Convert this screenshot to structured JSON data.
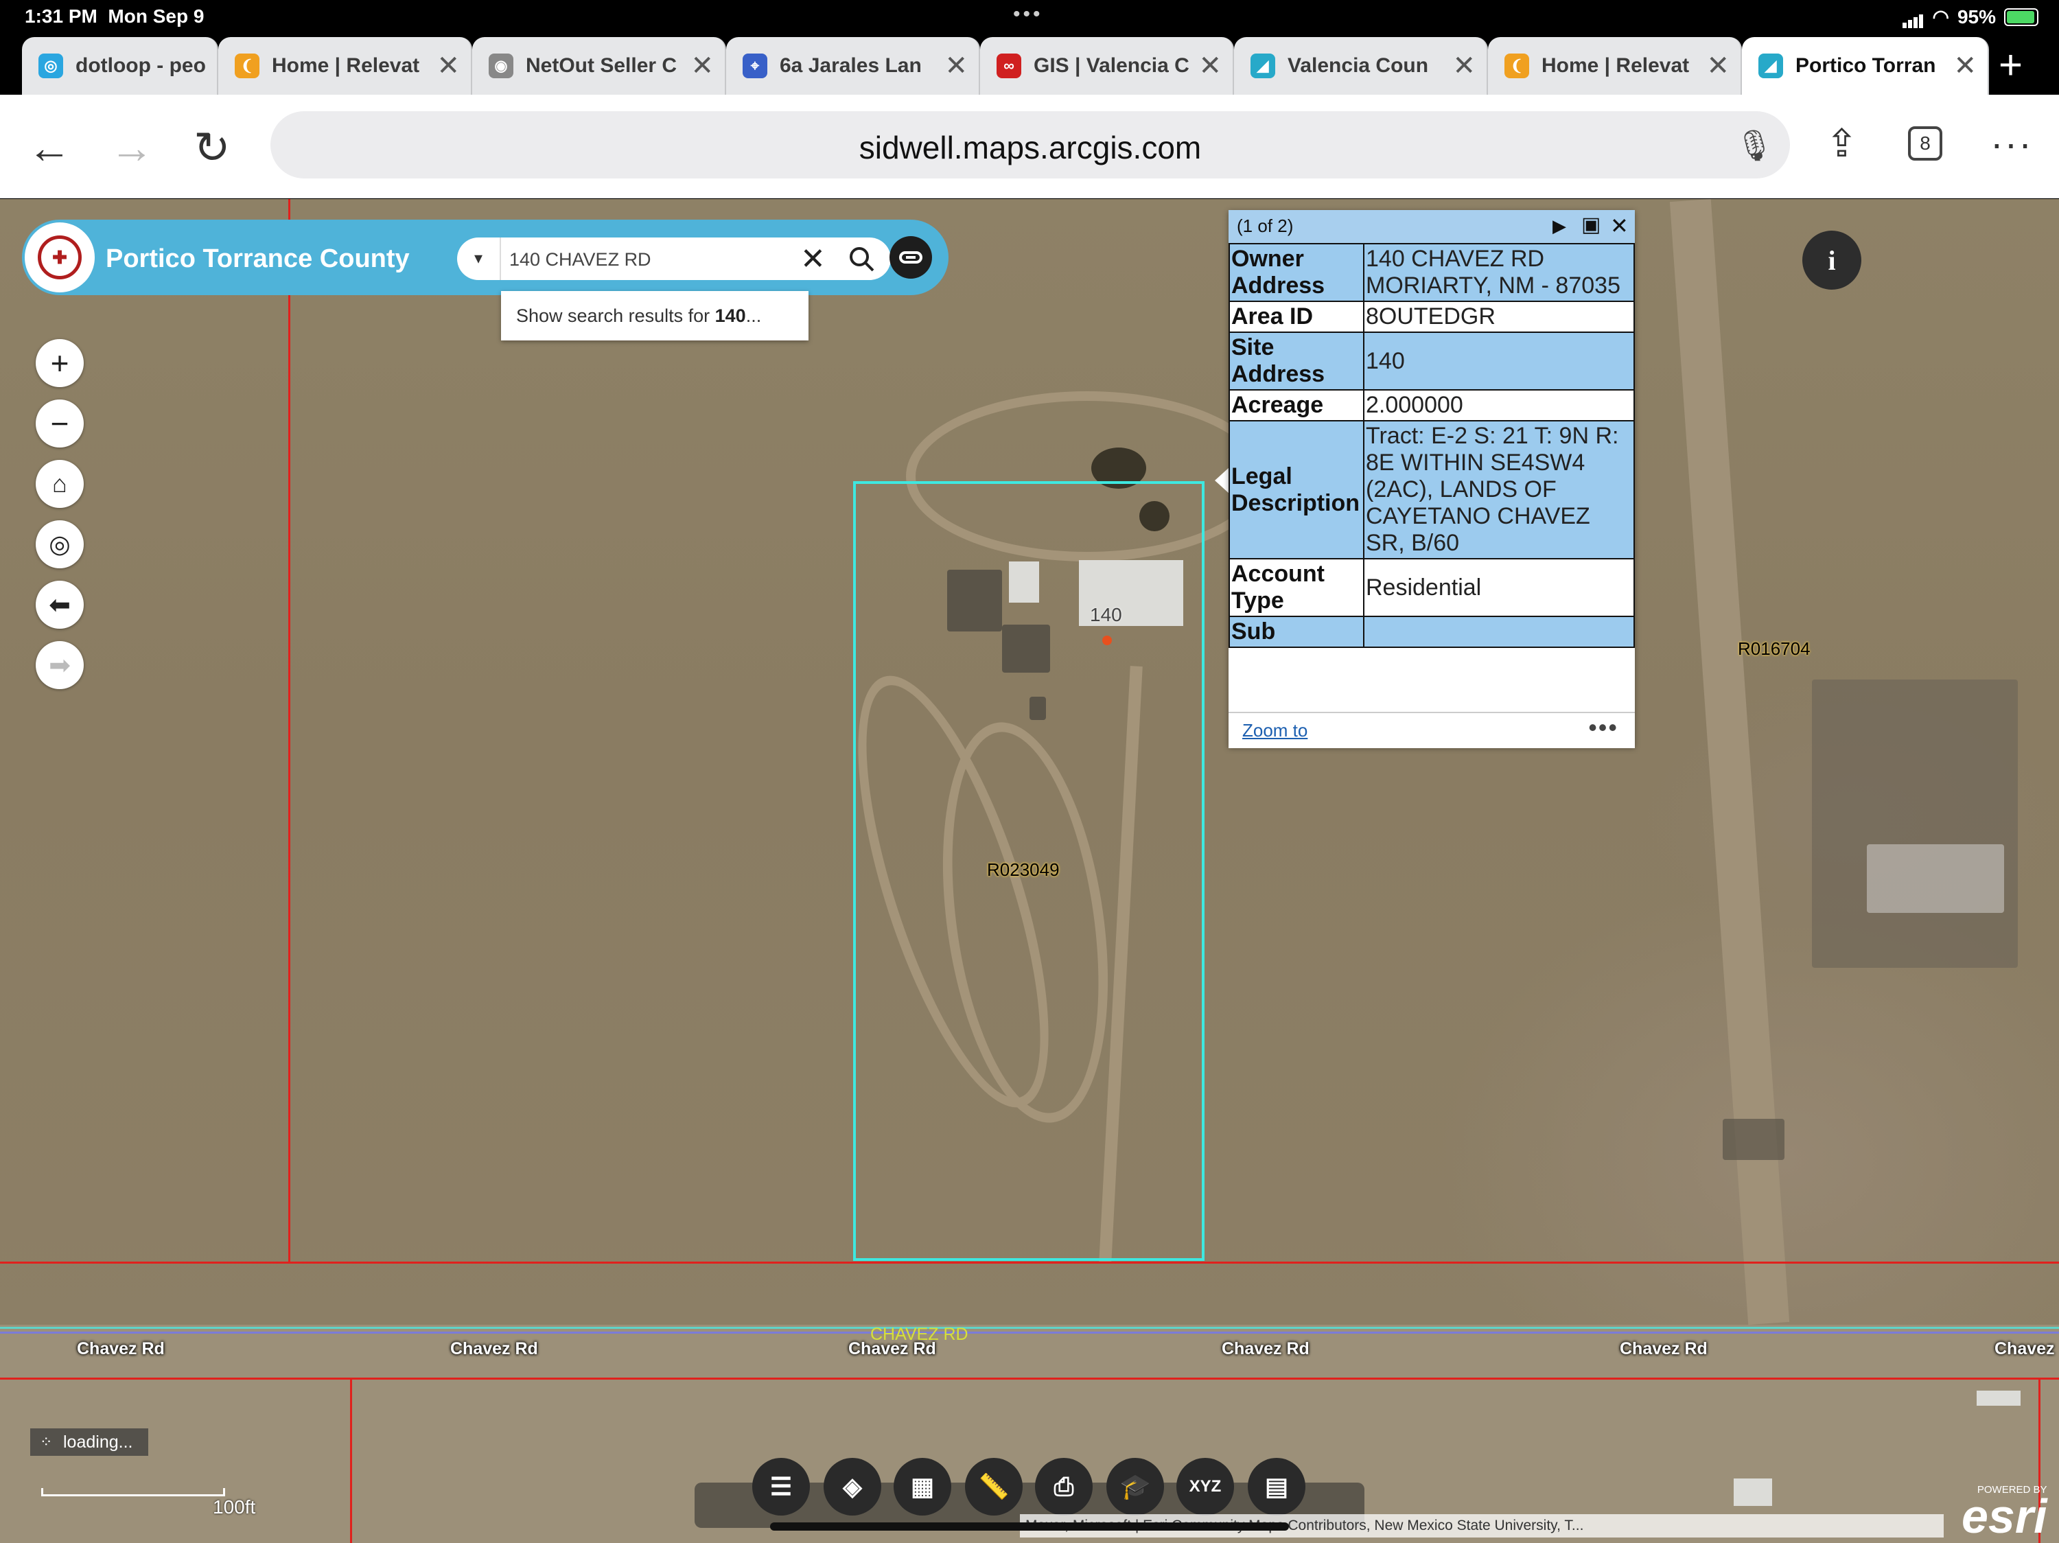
{
  "status": {
    "time": "1:31 PM",
    "date": "Mon Sep 9",
    "battery": "95%"
  },
  "tabs": [
    {
      "title": "dotloop - peo",
      "fav_color": "#2aa6e0",
      "fav_glyph": "◎"
    },
    {
      "title": "Home | Relevat",
      "fav_color": "#f0a020",
      "fav_glyph": "❨"
    },
    {
      "title": "NetOut Seller C",
      "fav_color": "#888888",
      "fav_glyph": "◉"
    },
    {
      "title": "6a Jarales Lan",
      "fav_color": "#3860c8",
      "fav_glyph": "⌖"
    },
    {
      "title": "GIS | Valencia C",
      "fav_color": "#d02020",
      "fav_glyph": "∞"
    },
    {
      "title": "Valencia Coun",
      "fav_color": "#27a9c9",
      "fav_glyph": "◢"
    },
    {
      "title": "Home | Relevat",
      "fav_color": "#f0a020",
      "fav_glyph": "❨"
    },
    {
      "title": "Portico Torran",
      "fav_color": "#27a9c9",
      "fav_glyph": "◢",
      "active": true
    }
  ],
  "toolbar": {
    "url": "sidwell.maps.arcgis.com",
    "tab_count": "8"
  },
  "app": {
    "title": "Portico Torrance County",
    "search_value": "140 CHAVEZ RD",
    "suggestion_prefix": "Show search results for ",
    "suggestion_bold": "140",
    "suggestion_suffix": "..."
  },
  "popup": {
    "count": "(1 of 2)",
    "rows": [
      {
        "key": "Owner Address",
        "value": "140 CHAVEZ RD MORIARTY,  NM - 87035"
      },
      {
        "key": "Area ID",
        "value": "8OUTEDGR"
      },
      {
        "key": "Site Address",
        "value": "140"
      },
      {
        "key": "Acreage",
        "value": "2.000000"
      },
      {
        "key": "Legal Description",
        "value": "Tract: E-2 S: 21 T: 9N R: 8E WITHIN SE4SW4 (2AC), LANDS OF CAYETANO CHAVEZ SR, B/60"
      },
      {
        "key": "Account Type",
        "value": "Residential"
      },
      {
        "key": "Sub",
        "value": ""
      }
    ],
    "zoom_to": "Zoom to"
  },
  "map_labels": {
    "parcel_selected": "R023049",
    "parcel_east": "R016704",
    "address_point": "140",
    "road_name": "CHAVEZ RD",
    "road_labels": [
      "Chavez Rd",
      "Chavez Rd",
      "Chavez Rd",
      "Chavez Rd",
      "Chavez Rd",
      "Chavez"
    ]
  },
  "bottom": {
    "loading": "loading...",
    "scale": "100ft",
    "tool_xyz": "XYZ",
    "attribution": "Maxar, Microsoft | Esri Community Maps Contributors, New Mexico State University, T...",
    "esri_powered": "POWERED BY",
    "esri_logo": "esri"
  },
  "colors": {
    "app_header": "#4fb3d9",
    "parcel_selected": "#3ee8e0",
    "parcel_line": "#e0211d",
    "popup_row": "#9ccbee"
  }
}
